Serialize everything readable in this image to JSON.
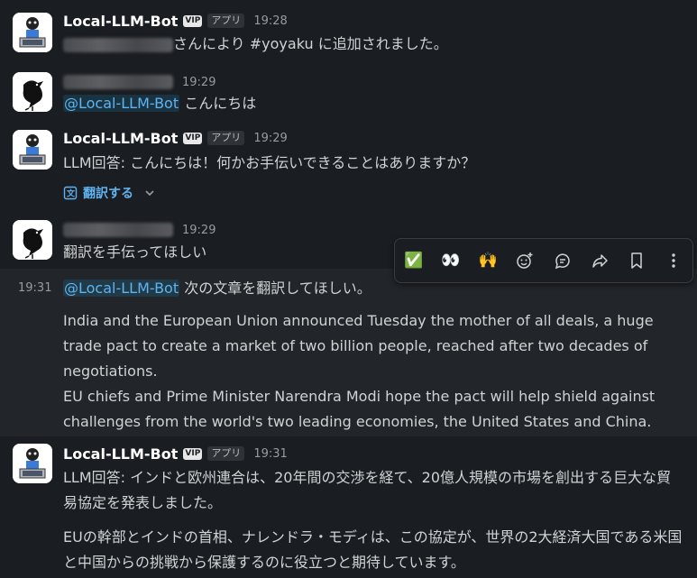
{
  "messages": {
    "m1": {
      "name": "Local-LLM-Bot",
      "vip": "VIP",
      "app_badge": "アプリ",
      "time": "19:28",
      "text": "さんにより #yoyaku に追加されました。"
    },
    "m2": {
      "time": "19:29",
      "mention": "@Local-LLM-Bot",
      "text": " こんにちは"
    },
    "m3": {
      "name": "Local-LLM-Bot",
      "vip": "VIP",
      "app_badge": "アプリ",
      "time": "19:29",
      "text": "LLM回答: こんにちは！何かお手伝いできることはありますか？",
      "translate_label": "翻訳する"
    },
    "m4": {
      "time": "19:29",
      "text": "翻訳を手伝ってほしい"
    },
    "m5": {
      "side_time": "19:31",
      "mention": "@Local-LLM-Bot",
      "text": " 次の文章を翻訳してほしい。",
      "para1": "India and the European Union announced Tuesday the mother of all deals, a huge trade pact to create a market of two billion people, reached after two decades of negotiations.",
      "para2": "EU chiefs and Prime Minister Narendra Modi hope the pact will help shield against challenges from the world's two leading economies, the United States and China."
    },
    "m6": {
      "name": "Local-LLM-Bot",
      "vip": "VIP",
      "app_badge": "アプリ",
      "time": "19:31",
      "text": "LLM回答: インドと欧州連合は、20年間の交渉を経て、20億人規模の市場を創出する巨大な貿易協定を発表しました。",
      "para2": "EUの幹部とインドの首相、ナレンドラ・モディは、この協定が、世界の2大経済大国である米国と中国からの挑戦から保護するのに役立つと期待しています。"
    }
  },
  "toolbar": {
    "react_check": "✅",
    "react_eyes": "👀",
    "react_raised_hands": "🙌"
  }
}
